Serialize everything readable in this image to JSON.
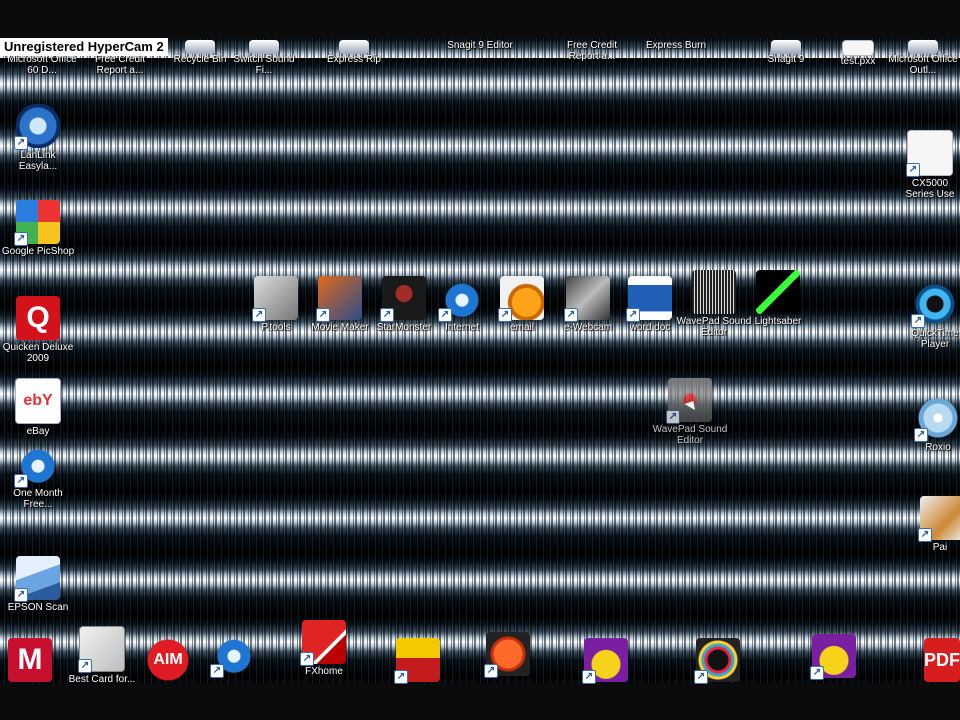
{
  "watermark": "Unregistered HyperCam 2",
  "top_icons": [
    {
      "name": "microsoft-office-60-day",
      "label": "Microsoft Office 60 D..."
    },
    {
      "name": "free-credit-report-1",
      "label": "Free Credit Report a..."
    },
    {
      "name": "recycle-bin",
      "label": "Recycle Bin"
    },
    {
      "name": "switch-sound-file",
      "label": "Switch Sound Fi..."
    },
    {
      "name": "express-rip",
      "label": "Express Rip"
    },
    {
      "name": "snagit-9-editor",
      "label": "Snagit 9 Editor"
    },
    {
      "name": "free-credit-report-2",
      "label": "Free Credit Report a..."
    },
    {
      "name": "express-burn",
      "label": "Express Burn"
    },
    {
      "name": "snagit-9",
      "label": "Snagit 9"
    },
    {
      "name": "test-pxx",
      "label": "test.pxx"
    },
    {
      "name": "microsoft-office-right",
      "label": "Microsoft Office Outl..."
    }
  ],
  "left_icons": [
    {
      "name": "lanlink",
      "label": "LanLink Easyla...",
      "glyph": ""
    },
    {
      "name": "google-picasa",
      "label": "Google PicShop",
      "glyph": ""
    },
    {
      "name": "quicken-deluxe-2009",
      "label": "Quicken Deluxe 2009",
      "glyph": "Q"
    },
    {
      "name": "ebay",
      "label": "eBay",
      "glyph": "ebY"
    },
    {
      "name": "one-month-free",
      "label": "One Month Free...",
      "glyph": "e"
    },
    {
      "name": "epson-scan",
      "label": "EPSON Scan",
      "glyph": ""
    }
  ],
  "middle_icons": [
    {
      "name": "tool-app",
      "label": "P.tools"
    },
    {
      "name": "movie-maker",
      "label": "Movie Maker"
    },
    {
      "name": "spider-app",
      "label": "StarMonster"
    },
    {
      "name": "internet-explorer",
      "label": "Internet"
    },
    {
      "name": "email",
      "label": "email"
    },
    {
      "name": "webcam",
      "label": "e-Webcam"
    },
    {
      "name": "word",
      "label": "word doc"
    },
    {
      "name": "wavepad-1",
      "label": "WavePad Sound Editor"
    },
    {
      "name": "laser-app",
      "label": "Lightsaber"
    }
  ],
  "wavepad_icon": {
    "name": "wavepad-sound-editor",
    "label": "WavePad Sound Editor"
  },
  "right_icons": [
    {
      "name": "cx5000-series",
      "label": "CX5000 Series Use"
    },
    {
      "name": "quicktime-player",
      "label": "QuickTime Player"
    },
    {
      "name": "disc-app",
      "label": "Roxio"
    },
    {
      "name": "paint-app",
      "label": "Pai"
    }
  ],
  "bottom_icons": [
    {
      "name": "mcafee",
      "label": "",
      "glyph": "M"
    },
    {
      "name": "best-card-for",
      "label": "Best Card for...",
      "glyph": ""
    },
    {
      "name": "aim",
      "label": "",
      "glyph": "AIM"
    },
    {
      "name": "internet-explorer-2",
      "label": "",
      "glyph": "e"
    },
    {
      "name": "fxhome",
      "label": "FXhome",
      "glyph": ""
    },
    {
      "name": "finance-app",
      "label": "",
      "glyph": ""
    },
    {
      "name": "record-app",
      "label": "",
      "glyph": ""
    },
    {
      "name": "yahoo-messenger-1",
      "label": "",
      "glyph": ""
    },
    {
      "name": "ring-app",
      "label": "",
      "glyph": ""
    },
    {
      "name": "yahoo-messenger-2",
      "label": "",
      "glyph": ""
    },
    {
      "name": "adobe-pdf",
      "label": "",
      "glyph": "PDF"
    }
  ]
}
